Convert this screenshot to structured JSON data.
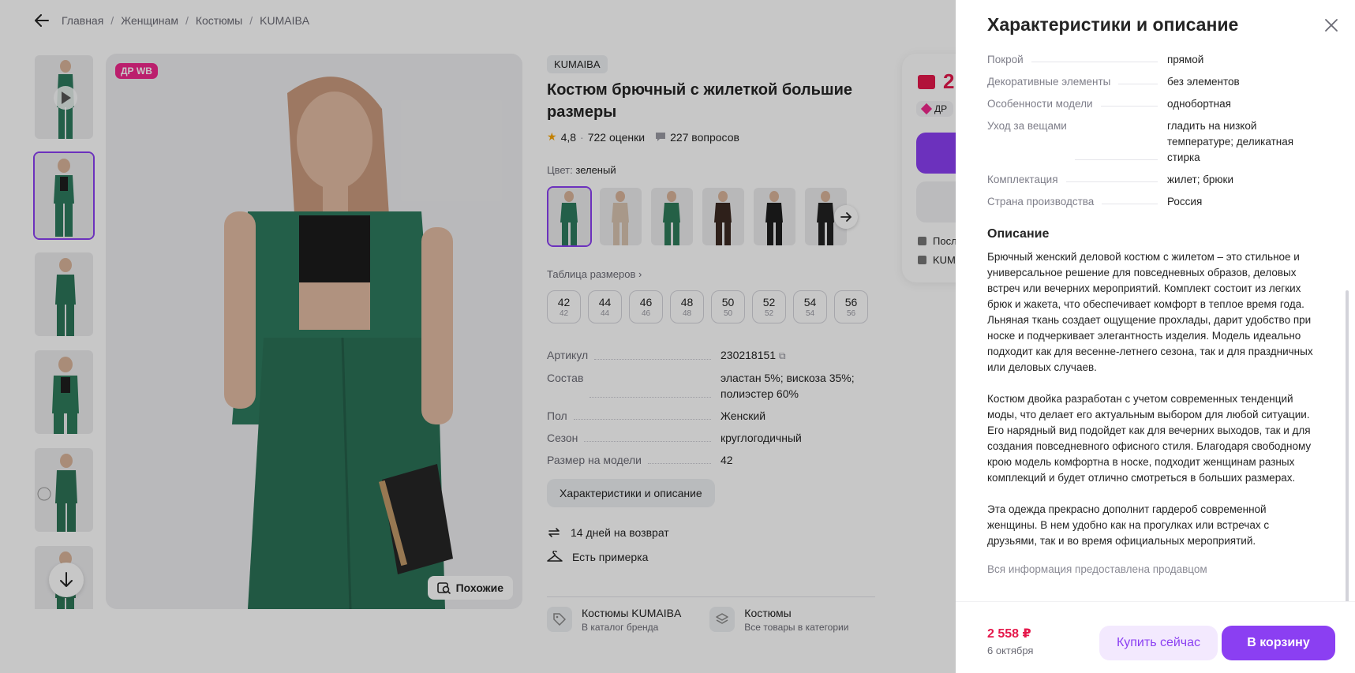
{
  "breadcrumb": {
    "items": [
      "Главная",
      "Женщинам",
      "Костюмы",
      "KUMAIBA"
    ],
    "separator": "/"
  },
  "gallery": {
    "badge": "ДР WB",
    "similar_label": "Похожие",
    "thumb_colors": [
      "#2e7a5e",
      "#2b6f57",
      "#2c7559",
      "#2f7b5b",
      "#2d7357",
      "#2e7858"
    ]
  },
  "product": {
    "brand": "KUMAIBA",
    "title": "Костюм брючный с жилеткой большие размеры",
    "rating": "4,8",
    "rating_sep": "·",
    "reviews": "722 оценки",
    "questions": "227 вопросов",
    "color_label": "Цвет:",
    "color_value": "зеленый",
    "size_table_label": "Таблица размеров",
    "sizes": [
      {
        "main": "42",
        "sub": "42"
      },
      {
        "main": "44",
        "sub": "44"
      },
      {
        "main": "46",
        "sub": "46"
      },
      {
        "main": "48",
        "sub": "48"
      },
      {
        "main": "50",
        "sub": "50"
      },
      {
        "main": "52",
        "sub": "52"
      },
      {
        "main": "54",
        "sub": "54"
      },
      {
        "main": "56",
        "sub": "56"
      }
    ],
    "params": [
      {
        "k": "Артикул",
        "v": "230218151"
      },
      {
        "k": "Состав",
        "v": "эластан 5%; вискоза 35%; полиэстер 60%"
      },
      {
        "k": "Пол",
        "v": "Женский"
      },
      {
        "k": "Сезон",
        "v": "круглогодичный"
      },
      {
        "k": "Размер на модели",
        "v": "42"
      }
    ],
    "char_button": "Характеристики и описание",
    "return_text": "14 дней на возврат",
    "fitting_text": "Есть примерка",
    "categories": [
      {
        "title": "Костюмы KUMAIBA",
        "sub": "В каталог бренда"
      },
      {
        "title": "Костюмы",
        "sub": "Все товары в категории"
      }
    ]
  },
  "buycard": {
    "price_partial": "2",
    "dr_partial": "ДР",
    "line1": "Посл",
    "line2": "KUM"
  },
  "drawer": {
    "title": "Характеристики и описание",
    "rows": [
      {
        "k": "Покрой",
        "v": "прямой"
      },
      {
        "k": "Декоративные элементы",
        "v": "без элементов"
      },
      {
        "k": "Особенности модели",
        "v": "однобортная"
      },
      {
        "k": "Уход за вещами",
        "v": "гладить на низкой температуре; деликатная стирка"
      },
      {
        "k": "Комплектация",
        "v": "жилет; брюки"
      },
      {
        "k": "Страна производства",
        "v": "Россия"
      }
    ],
    "desc_heading": "Описание",
    "desc_p1": "Брючный женский деловой костюм с жилетом – это стильное и универсальное решение для повседневных образов, деловых встреч или вечерних мероприятий. Комплект состоит из легких брюк и жакета, что обеспечивает комфорт в теплое время года. Льняная ткань создает ощущение прохлады, дарит удобство при носке и подчеркивает элегантность изделия. Модель идеально подходит как для весенне-летнего сезона, так и для праздничных или деловых случаев.",
    "desc_p2": "Костюм двойка разработан с учетом современных тенденций моды, что делает его актуальным выбором для любой ситуации. Его нарядный вид подойдет как для вечерних выходов, так и для создания повседневного офисного стиля. Благодаря свободному крою модель комфортна в носке, подходит женщинам разных комплекций и будет отлично смотреться в больших размерах.",
    "desc_p3": "Эта одежда прекрасно дополнит гардероб современной женщины. В нем удобно как на прогулках или встречах с друзьями, так и во время официальных мероприятий.",
    "note": "Вся информация предоставлена продавцом",
    "footer": {
      "price": "2 558 ₽",
      "date": "6 октября",
      "buy_now": "Купить сейчас",
      "to_cart": "В корзину"
    }
  },
  "colors": {
    "accent": "#8b3ff2",
    "price": "#e5184b",
    "badge": "#f0288c",
    "suit": "#2e7a5e"
  }
}
